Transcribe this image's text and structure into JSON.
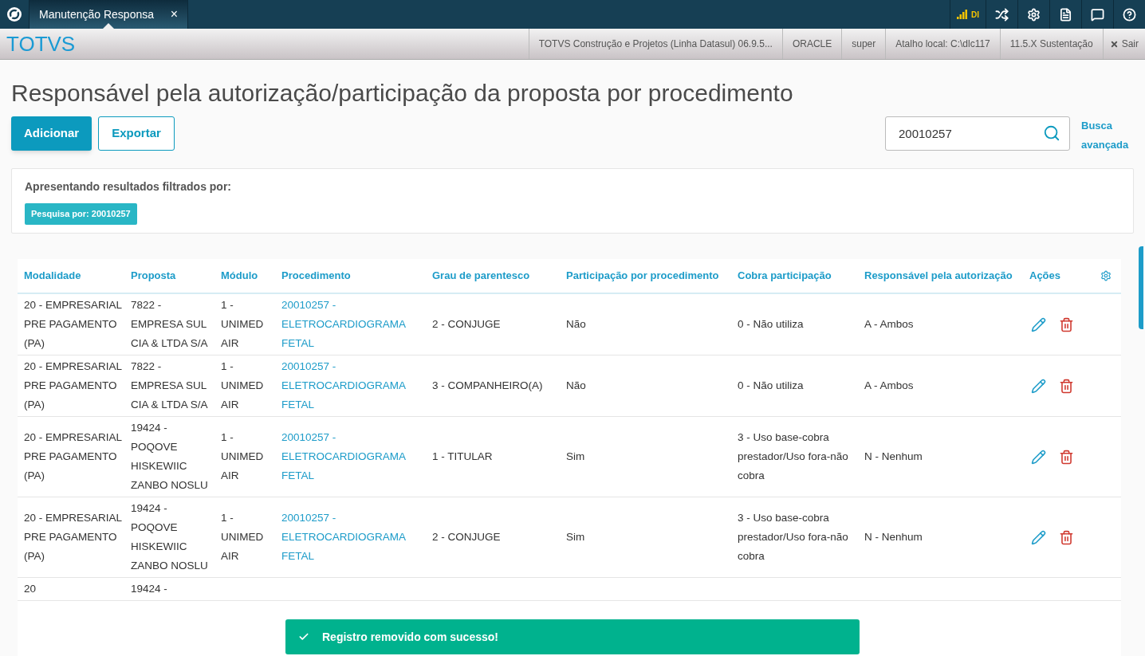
{
  "topbar": {
    "tab": {
      "label": "Manutenção Responsa",
      "close": "×",
      "selected": true
    },
    "connection": "DI"
  },
  "header": {
    "brand": "TOTVS",
    "items": [
      "TOTVS Construção e Projetos (Linha Datasul) 06.9.5...",
      "ORACLE",
      "super",
      "Atalho local: C:\\dlc117",
      "11.5.X Sustentação"
    ],
    "logout": "Sair"
  },
  "page": {
    "title": "Responsável pela autorização/participação da proposta por procedimento",
    "buttons": [
      {
        "label": "Adicionar",
        "kind": "primary"
      },
      {
        "label": "Exportar",
        "kind": "secondary"
      }
    ],
    "search": {
      "value": "20010257"
    },
    "advanced_search": "Busca avançada"
  },
  "filter": {
    "label": "Apresentando resultados filtrados por:",
    "tags": [
      "Pesquisa por: 20010257"
    ]
  },
  "table": {
    "columns": [
      "Modalidade",
      "Proposta",
      "Módulo",
      "Procedimento",
      "Grau de parentesco",
      "Participação por procedimento",
      "Cobra participação",
      "Responsável pela autorização",
      "Ações"
    ],
    "rows": [
      {
        "modalidade": "20 - EMPRESARIAL PRE PAGAMENTO (PA)",
        "proposta": "7822 - EMPRESA SUL CIA & LTDA S/A",
        "modulo": "1 - UNIMED AIR",
        "procedimento": "20010257 - ELETROCARDIOGRAMA FETAL",
        "grau": "2 - CONJUGE",
        "participacao": "Não",
        "cobra": "0 - Não utiliza",
        "responsavel": "A - Ambos"
      },
      {
        "modalidade": "20 - EMPRESARIAL PRE PAGAMENTO (PA)",
        "proposta": "7822 - EMPRESA SUL CIA & LTDA S/A",
        "modulo": "1 - UNIMED AIR",
        "procedimento": "20010257 - ELETROCARDIOGRAMA FETAL",
        "grau": "3 - COMPANHEIRO(A)",
        "participacao": "Não",
        "cobra": "0 - Não utiliza",
        "responsavel": "A - Ambos"
      },
      {
        "modalidade": "20 - EMPRESARIAL PRE PAGAMENTO (PA)",
        "proposta": "19424 - POQOVE HISKEWIIC ZANBO NOSLU",
        "modulo": "1 - UNIMED AIR",
        "procedimento": "20010257 - ELETROCARDIOGRAMA FETAL",
        "grau": "1 - TITULAR",
        "participacao": "Sim",
        "cobra": "3 - Uso base-cobra prestador/Uso fora-não cobra",
        "responsavel": "N - Nenhum"
      },
      {
        "modalidade": "20 - EMPRESARIAL PRE PAGAMENTO (PA)",
        "proposta": "19424 - POQOVE HISKEWIIC ZANBO NOSLU",
        "modulo": "1 - UNIMED AIR",
        "procedimento": "20010257 - ELETROCARDIOGRAMA FETAL",
        "grau": "2 - CONJUGE",
        "participacao": "Sim",
        "cobra": "3 - Uso base-cobra prestador/Uso fora-não cobra",
        "responsavel": "N - Nenhum"
      },
      {
        "modalidade": "20",
        "proposta": "19424 -"
      }
    ]
  },
  "toast": {
    "message": "Registro removido com sucesso!",
    "kind": "success"
  }
}
